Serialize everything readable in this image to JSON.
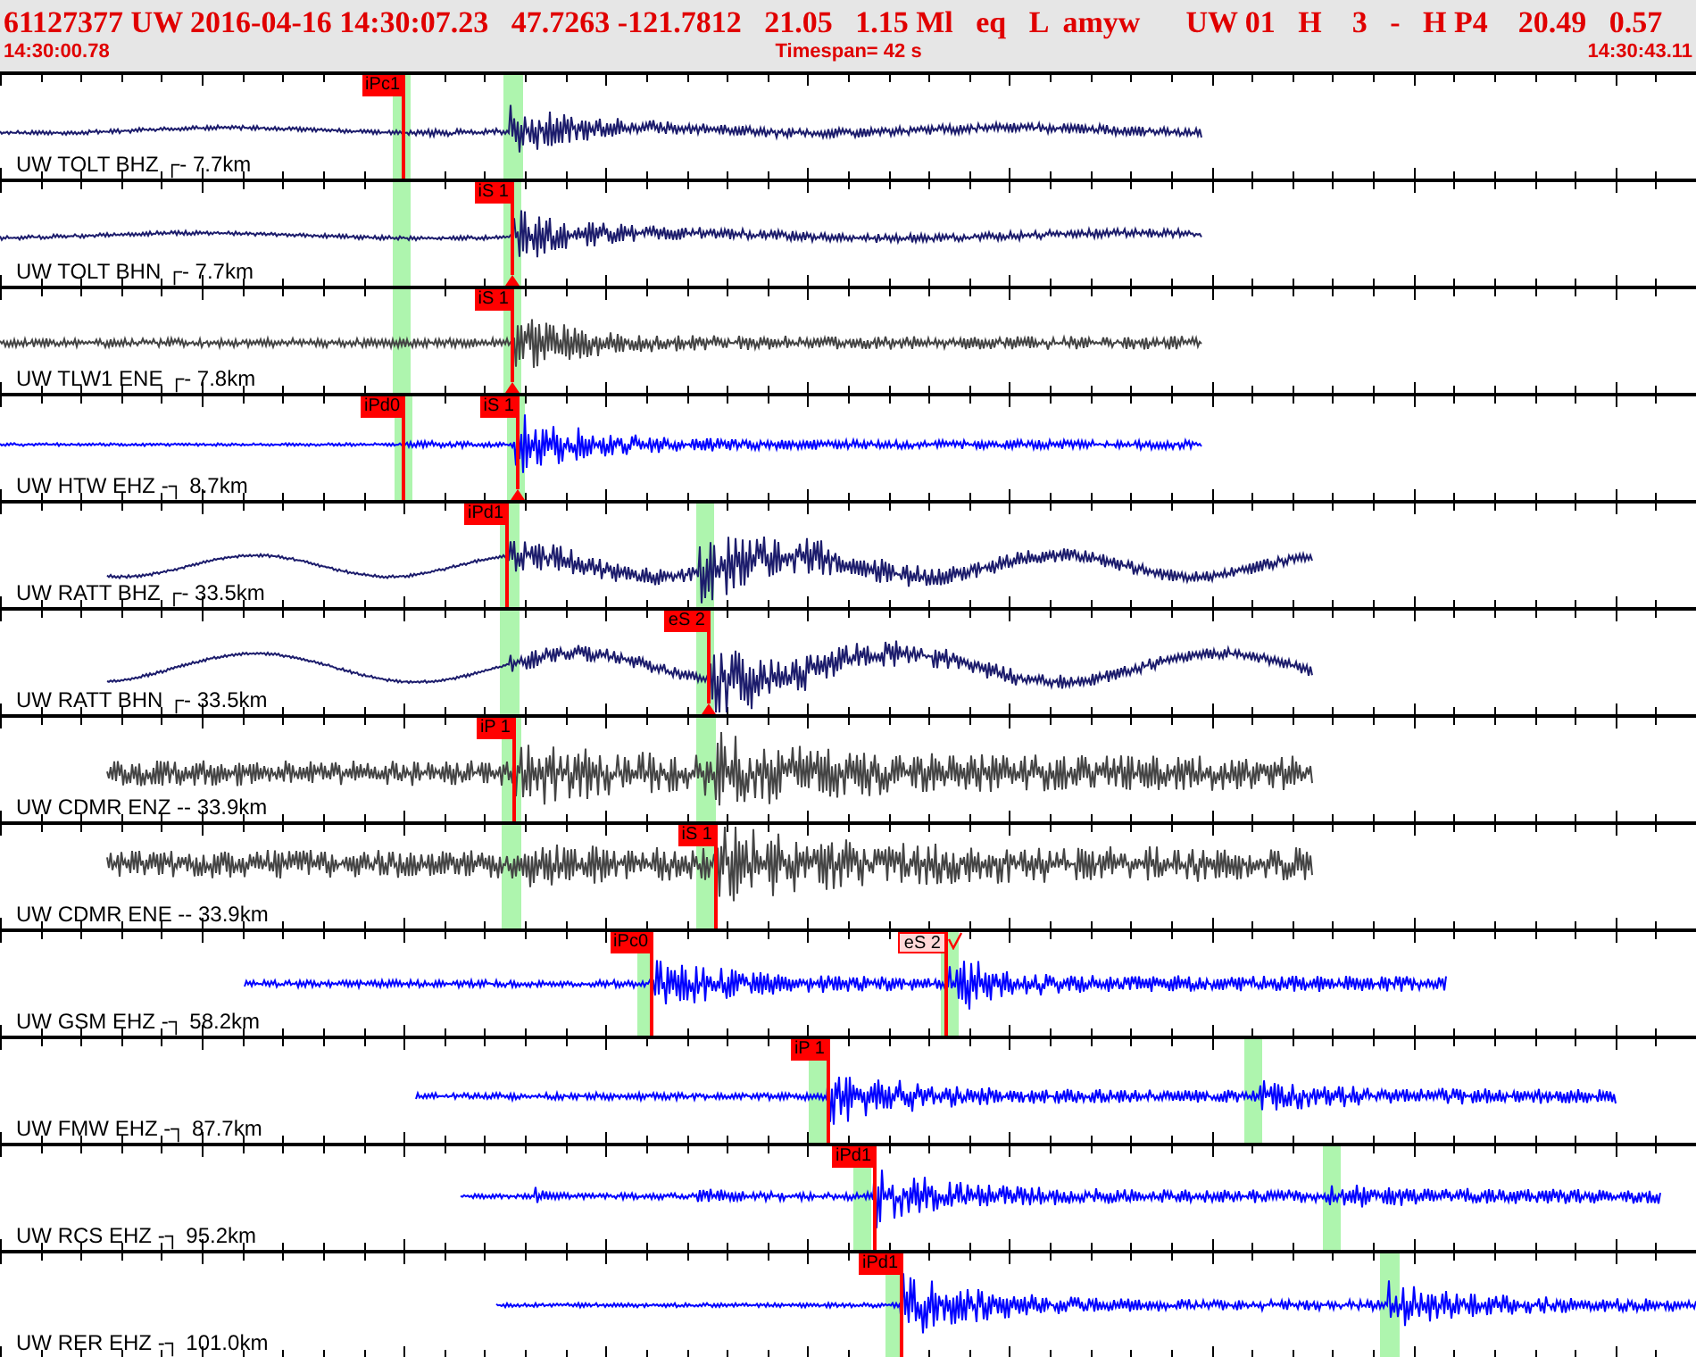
{
  "header": {
    "event_line": "61127377 UW 2016-04-16 14:30:07.23   47.7263 -121.7812   21.05   1.15 Ml   eq   L  amyw      UW 01   H    3   -   H P4    20.49   0.57",
    "start_time": "14:30:00.78",
    "timespan": "Timespan=  42 s",
    "end_time": "14:30:43.11"
  },
  "traces": [
    {
      "label": "UW TOLT BHZ ┌- 7.7km",
      "color": "#1c1c6c",
      "picks": [
        {
          "label": "iPc1",
          "kind": "solid"
        }
      ]
    },
    {
      "label": "UW TOLT BHN ┌- 7.7km",
      "color": "#1c1c6c",
      "picks": [
        {
          "label": "iS 1",
          "kind": "solid"
        }
      ]
    },
    {
      "label": "UW TLW1 ENE ┌- 7.8km",
      "color": "#444444",
      "picks": [
        {
          "label": "iS 1",
          "kind": "solid"
        }
      ]
    },
    {
      "label": "UW HTW EHZ -┐ 8.7km",
      "color": "#0000ff",
      "picks": [
        {
          "label": "iPd0",
          "kind": "solid"
        },
        {
          "label": "iS 1",
          "kind": "solid"
        }
      ]
    },
    {
      "label": "UW RATT BHZ ┌- 33.5km",
      "color": "#1c1c6c",
      "picks": [
        {
          "label": "iPd1",
          "kind": "solid"
        }
      ]
    },
    {
      "label": "UW RATT BHN ┌- 33.5km",
      "color": "#1c1c6c",
      "picks": [
        {
          "label": "eS 2",
          "kind": "solid"
        }
      ]
    },
    {
      "label": "UW CDMR ENZ -- 33.9km",
      "color": "#444444",
      "picks": [
        {
          "label": "iP 1",
          "kind": "solid"
        }
      ]
    },
    {
      "label": "UW CDMR ENE -- 33.9km",
      "color": "#444444",
      "picks": [
        {
          "label": "iS 1",
          "kind": "solid"
        }
      ]
    },
    {
      "label": "UW GSM EHZ -┐ 58.2km",
      "color": "#0000ff",
      "picks": [
        {
          "label": "iPc0",
          "kind": "solid"
        },
        {
          "label": "eS 2",
          "kind": "outline"
        }
      ]
    },
    {
      "label": "UW FMW EHZ -┐ 87.7km",
      "color": "#0000ff",
      "picks": [
        {
          "label": "iP 1",
          "kind": "solid"
        }
      ]
    },
    {
      "label": "UW RCS EHZ -┐ 95.2km",
      "color": "#0000ff",
      "picks": [
        {
          "label": "iPd1",
          "kind": "solid"
        }
      ]
    },
    {
      "label": "UW RER EHZ -┐ 101.0km",
      "color": "#0000ff",
      "picks": [
        {
          "label": "iPd1",
          "kind": "solid"
        }
      ]
    }
  ]
}
